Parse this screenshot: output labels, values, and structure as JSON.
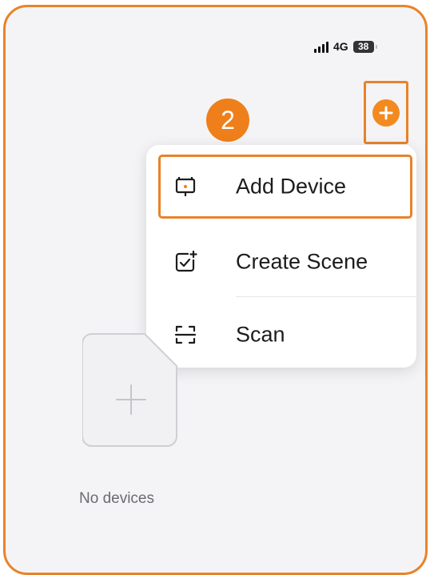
{
  "status_bar": {
    "network": "4G",
    "battery": "38"
  },
  "step_badge": "2",
  "menu": {
    "items": [
      {
        "label": "Add Device",
        "icon": "add-device-icon",
        "highlighted": true
      },
      {
        "label": "Create Scene",
        "icon": "create-scene-icon",
        "highlighted": false
      },
      {
        "label": "Scan",
        "icon": "scan-icon",
        "highlighted": false
      }
    ]
  },
  "empty_state": {
    "text": "No devices"
  },
  "colors": {
    "accent": "#ef7f1a",
    "highlight_border": "#e8832a",
    "background": "#f4f4f6",
    "text": "#1c1c1e"
  }
}
